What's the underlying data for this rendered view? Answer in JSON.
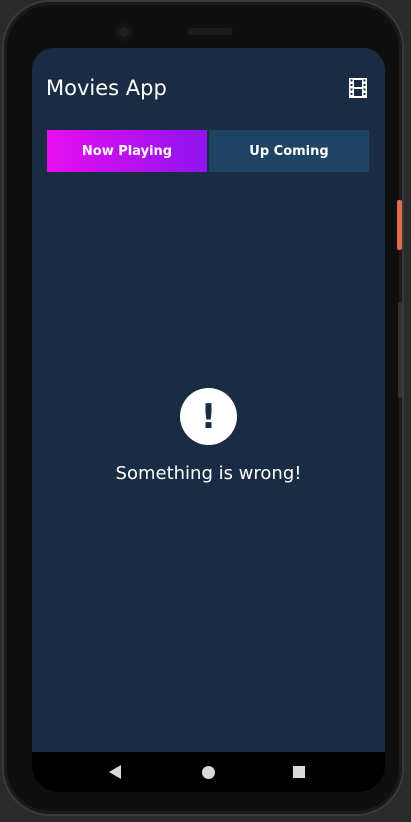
{
  "app_bar": {
    "title": "Movies App",
    "icon": "film-icon"
  },
  "tabs": [
    {
      "label": "Now Playing",
      "selected": true
    },
    {
      "label": "Up Coming",
      "selected": false
    }
  ],
  "error": {
    "icon": "alert-icon",
    "mark": "!",
    "message": "Something is wrong!"
  },
  "nav_bar": {
    "icons": [
      "back-icon",
      "home-icon",
      "recents-icon"
    ]
  },
  "colors": {
    "background": "#1a2c44",
    "tab_selected_start": "#e80df0",
    "tab_selected_end": "#8e14f0",
    "tab_unselected": "#1f4363",
    "text": "#ffffff"
  }
}
